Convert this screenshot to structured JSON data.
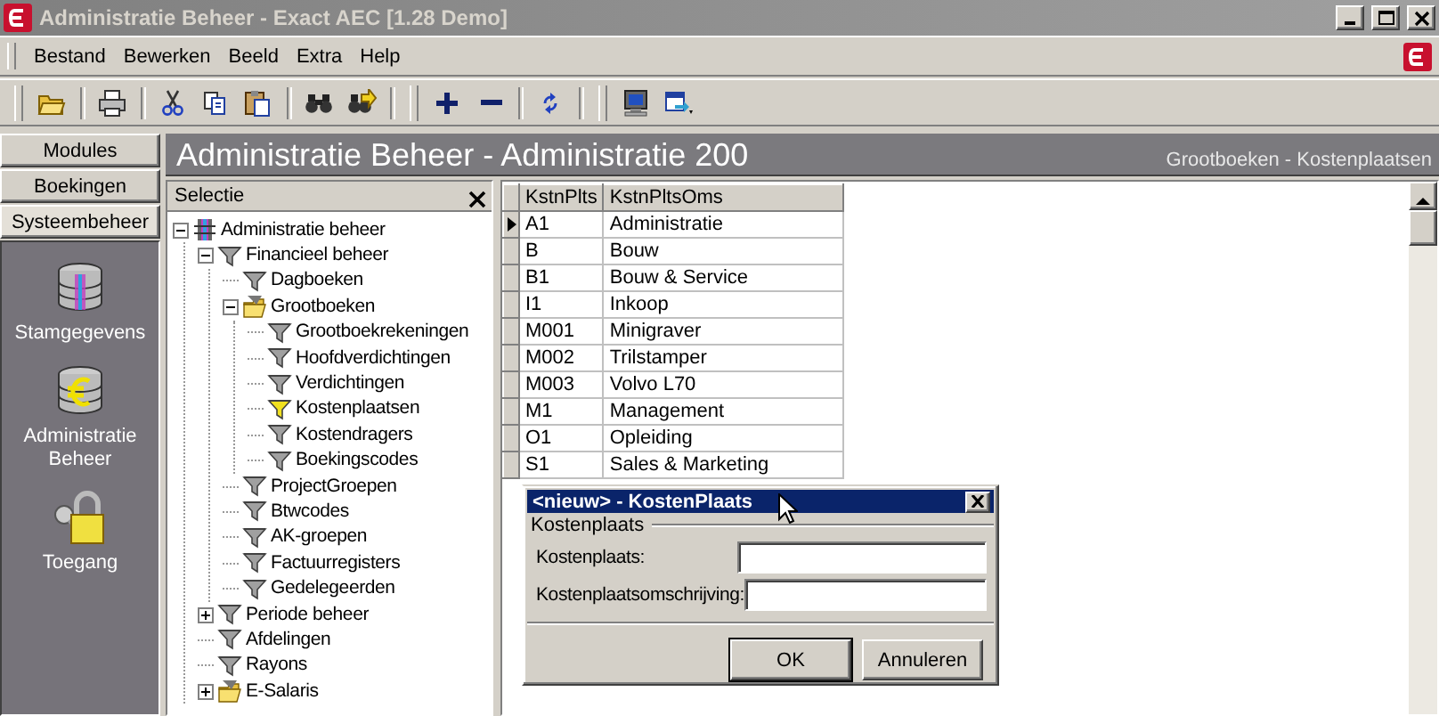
{
  "window": {
    "title": "Administratie Beheer - Exact AEC [1.28 Demo]"
  },
  "menu": [
    "Bestand",
    "Bewerken",
    "Beeld",
    "Extra",
    "Help"
  ],
  "modules": {
    "tabs": [
      {
        "label": "Modules",
        "selected": false
      },
      {
        "label": "Boekingen",
        "selected": false
      },
      {
        "label": "Systeembeheer",
        "selected": true
      }
    ],
    "items": [
      {
        "label": "Stamgegevens",
        "kind": "database"
      },
      {
        "label": "Administratie Beheer",
        "kind": "euro"
      },
      {
        "label": "Toegang",
        "kind": "lock"
      }
    ]
  },
  "header": {
    "title": "Administratie Beheer - Administratie 200",
    "subtitle": "Grootboeken - Kostenplaatsen"
  },
  "selection_panel": {
    "title": "Selectie"
  },
  "tree": [
    {
      "label": "Administratie beheer",
      "kind": "root",
      "expanded": true,
      "children": [
        {
          "label": "Financieel beheer",
          "kind": "filter",
          "expanded": true,
          "selected": false,
          "children": [
            {
              "label": "Dagboeken",
              "kind": "filter",
              "selected": false
            },
            {
              "label": "Grootboeken",
              "kind": "folder",
              "expanded": true,
              "children": [
                {
                  "label": "Grootboekrekeningen",
                  "kind": "filter",
                  "selected": false
                },
                {
                  "label": "Hoofdverdichtingen",
                  "kind": "filter",
                  "selected": false
                },
                {
                  "label": "Verdichtingen",
                  "kind": "filter",
                  "selected": false
                },
                {
                  "label": "Kostenplaatsen",
                  "kind": "filter",
                  "selected": true
                },
                {
                  "label": "Kostendragers",
                  "kind": "filter",
                  "selected": false
                },
                {
                  "label": "Boekingscodes",
                  "kind": "filter",
                  "selected": false
                }
              ]
            },
            {
              "label": "ProjectGroepen",
              "kind": "filter",
              "selected": false
            },
            {
              "label": "Btwcodes",
              "kind": "filter",
              "selected": false
            },
            {
              "label": "AK-groepen",
              "kind": "filter",
              "selected": false
            },
            {
              "label": "Factuurregisters",
              "kind": "filter",
              "selected": false
            },
            {
              "label": "Gedelegeerden",
              "kind": "filter",
              "selected": false
            }
          ]
        },
        {
          "label": "Periode beheer",
          "kind": "filter",
          "expanded": false,
          "selected": false
        },
        {
          "label": "Afdelingen",
          "kind": "filter",
          "selected": false
        },
        {
          "label": "Rayons",
          "kind": "filter",
          "selected": false
        },
        {
          "label": "E-Salaris",
          "kind": "folder",
          "expanded": false
        }
      ]
    }
  ],
  "table": {
    "columns": [
      "KstnPlts",
      "KstnPltsOms"
    ],
    "rows": [
      {
        "cells": [
          "A1",
          "Administratie"
        ],
        "selected": true
      },
      {
        "cells": [
          "B",
          "Bouw"
        ],
        "selected": false
      },
      {
        "cells": [
          "B1",
          "Bouw & Service"
        ],
        "selected": false
      },
      {
        "cells": [
          "I1",
          "Inkoop"
        ],
        "selected": false
      },
      {
        "cells": [
          "M001",
          "Minigraver"
        ],
        "selected": false
      },
      {
        "cells": [
          "M002",
          "Trilstamper"
        ],
        "selected": false
      },
      {
        "cells": [
          "M003",
          "Volvo L70"
        ],
        "selected": false
      },
      {
        "cells": [
          "M1",
          "Management"
        ],
        "selected": false
      },
      {
        "cells": [
          "O1",
          "Opleiding"
        ],
        "selected": false
      },
      {
        "cells": [
          "S1",
          "Sales & Marketing"
        ],
        "selected": false
      }
    ]
  },
  "dialog": {
    "title": "<nieuw> - KostenPlaats",
    "group": "Kostenplaats",
    "fields": [
      {
        "label": "Kostenplaats:"
      },
      {
        "label": "Kostenplaatsomschrijving:"
      }
    ],
    "buttons": [
      {
        "label": "OK",
        "default": true
      },
      {
        "label": "Annuleren",
        "default": false
      }
    ]
  }
}
